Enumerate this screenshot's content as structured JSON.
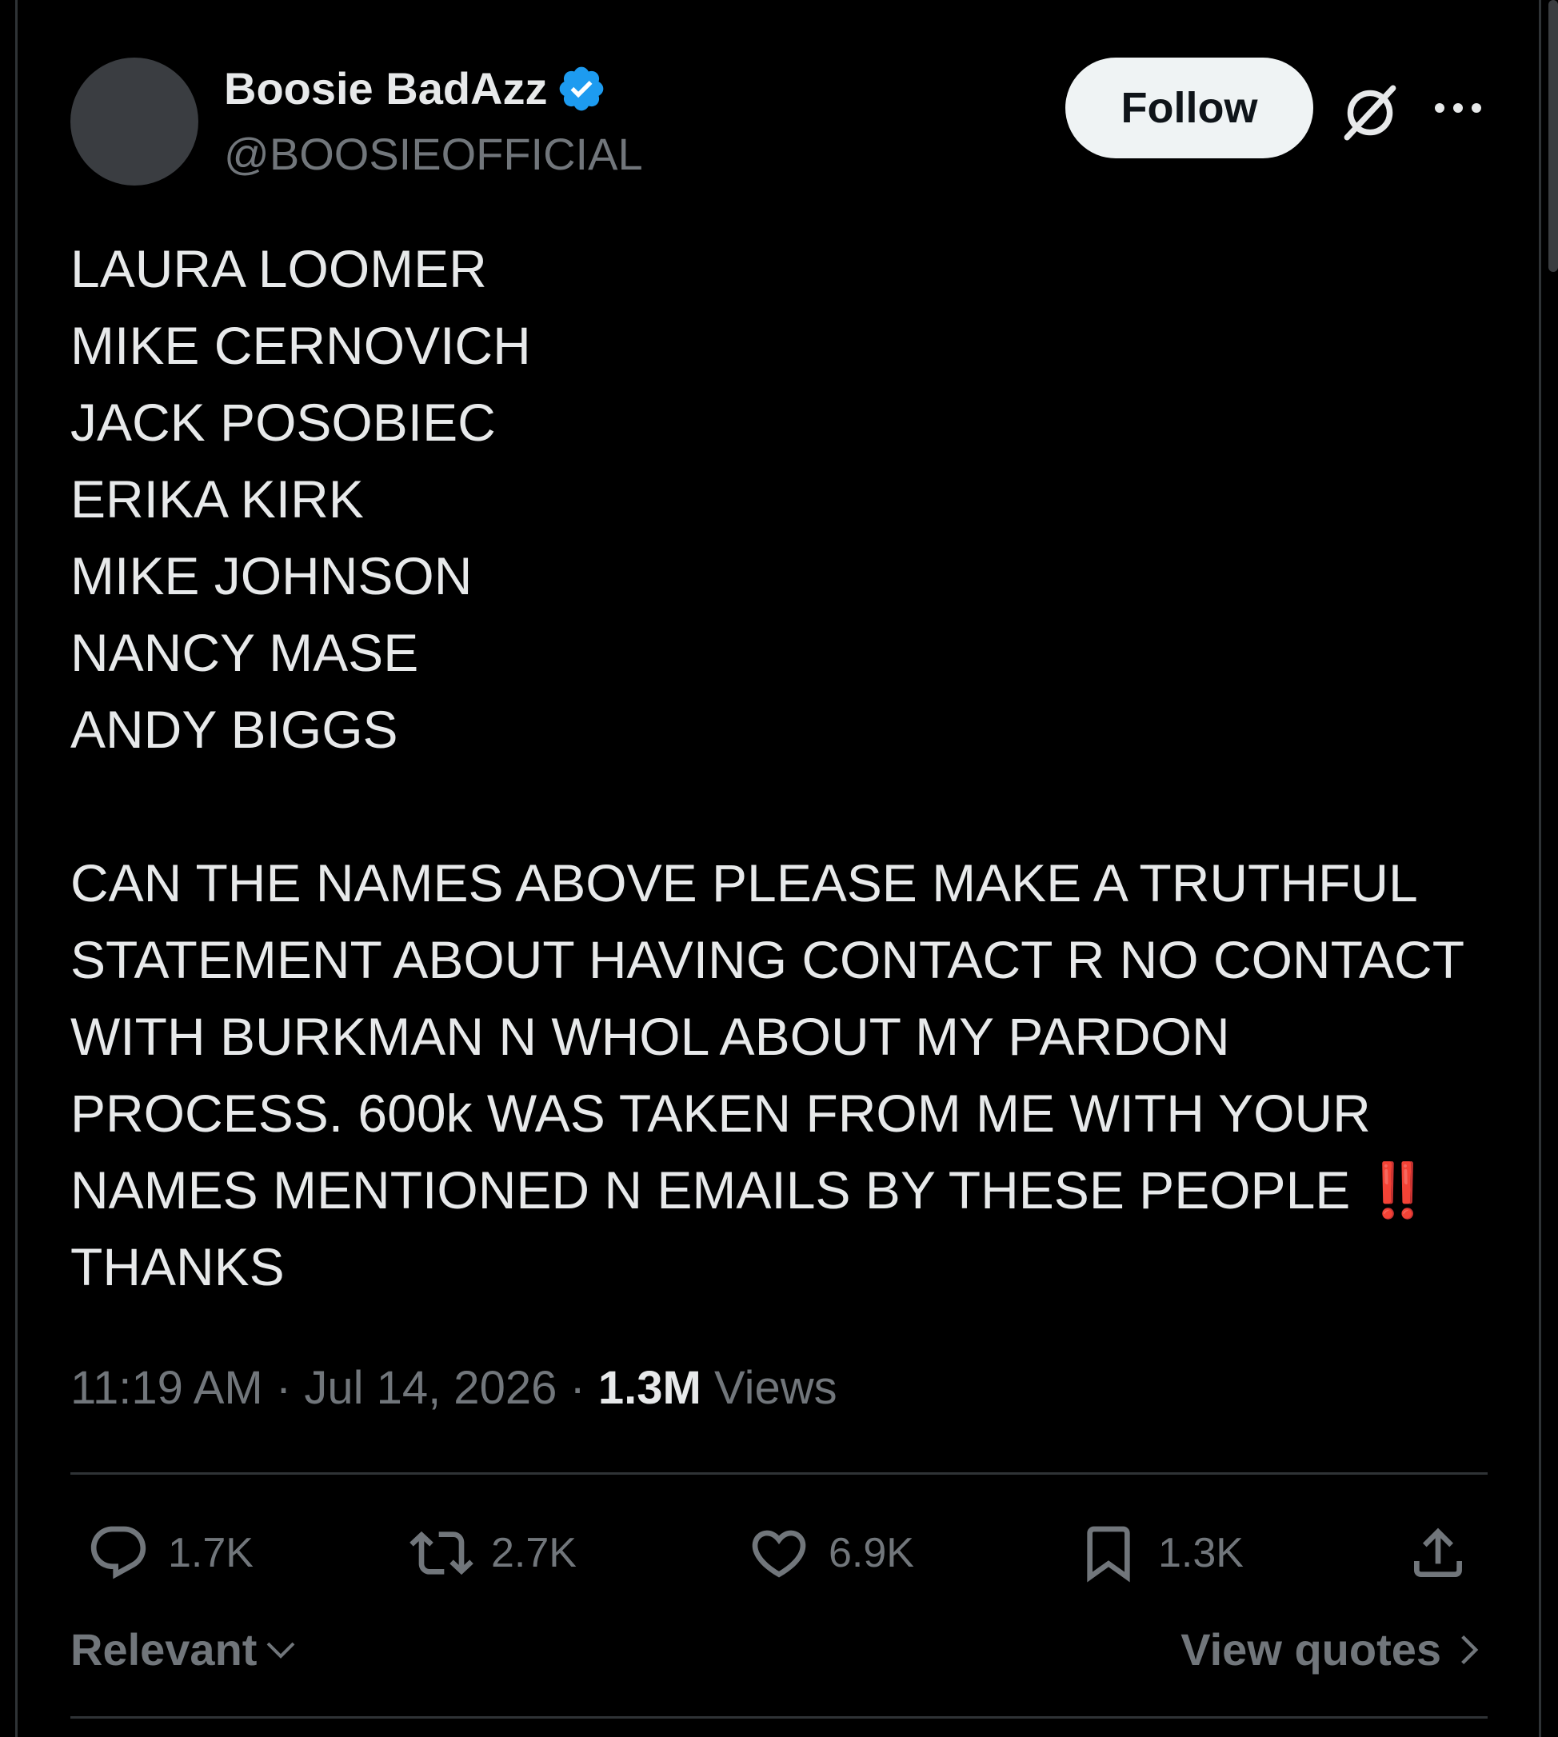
{
  "author": {
    "display_name": "Boosie BadAzz",
    "handle": "@BOOSIEOFFICIAL",
    "verified": true,
    "verified_color": "#1d9bf0"
  },
  "header": {
    "follow_label": "Follow"
  },
  "tweet": {
    "names": [
      "LAURA LOOMER",
      "MIKE CERNOVICH",
      "JACK POSOBIEC",
      "ERIKA KIRK",
      "MIKE JOHNSON",
      "NANCY MASE",
      "ANDY BIGGS"
    ],
    "paragraph": [
      "CAN THE NAMES ABOVE PLEASE MAKE A TRUTHFUL",
      "STATEMENT ABOUT HAVING CONTACT R NO CONTACT",
      "WITH BURKMAN N WHOL ABOUT MY PARDON",
      "PROCESS. 600k WAS TAKEN FROM ME WITH YOUR",
      "NAMES MENTIONED N EMAILS BY THESE  PEOPLE ",
      "THANKS"
    ],
    "emoji": "‼️",
    "emoji_color": "#e0245e"
  },
  "meta": {
    "time": "11:19 AM",
    "separator": " · ",
    "date": "Jul 14, 2026",
    "views_count": "1.3M",
    "views_label": " Views"
  },
  "actions": {
    "replies": "1.7K",
    "reposts": "2.7K",
    "likes": "6.9K",
    "bookmarks": "1.3K"
  },
  "footer": {
    "sort_label": "Relevant",
    "view_quotes_label": "View quotes"
  },
  "colors": {
    "background": "#000000",
    "text": "#e7e9ea",
    "muted": "#71767b",
    "divider": "#2f3336",
    "follow_bg": "#eff3f4"
  }
}
